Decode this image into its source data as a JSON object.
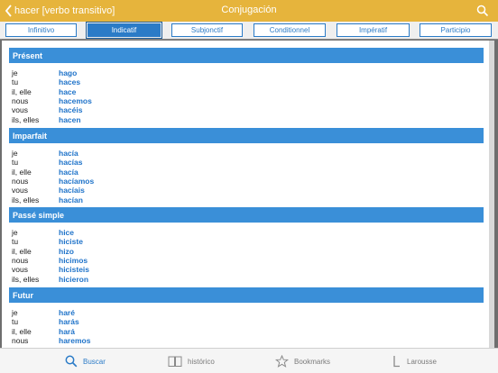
{
  "header": {
    "back_label": "hacer [verbo transitivo]",
    "title": "Conjugación"
  },
  "tabs": [
    {
      "label": "Infinitivo"
    },
    {
      "label": "Indicatif"
    },
    {
      "label": "Subjonctif"
    },
    {
      "label": "Conditionnel"
    },
    {
      "label": "Impératif"
    },
    {
      "label": "Participio"
    }
  ],
  "sections": [
    {
      "title": "Présent",
      "rows": [
        {
          "pronoun": "je",
          "form": "hago"
        },
        {
          "pronoun": "tu",
          "form": "haces"
        },
        {
          "pronoun": "il, elle",
          "form": "hace"
        },
        {
          "pronoun": "nous",
          "form": "hacemos"
        },
        {
          "pronoun": "vous",
          "form": "hacéis"
        },
        {
          "pronoun": "ils, elles",
          "form": "hacen"
        }
      ]
    },
    {
      "title": "Imparfait",
      "rows": [
        {
          "pronoun": "je",
          "form": "hacía"
        },
        {
          "pronoun": "tu",
          "form": "hacías"
        },
        {
          "pronoun": "il, elle",
          "form": "hacía"
        },
        {
          "pronoun": "nous",
          "form": "hacíamos"
        },
        {
          "pronoun": "vous",
          "form": "hacíais"
        },
        {
          "pronoun": "ils, elles",
          "form": "hacían"
        }
      ]
    },
    {
      "title": "Passé simple",
      "rows": [
        {
          "pronoun": "je",
          "form": "hice"
        },
        {
          "pronoun": "tu",
          "form": "hiciste"
        },
        {
          "pronoun": "il, elle",
          "form": "hizo"
        },
        {
          "pronoun": "nous",
          "form": "hicimos"
        },
        {
          "pronoun": "vous",
          "form": "hicisteis"
        },
        {
          "pronoun": "ils, elles",
          "form": "hicieron"
        }
      ]
    },
    {
      "title": "Futur",
      "rows": [
        {
          "pronoun": "je",
          "form": "haré"
        },
        {
          "pronoun": "tu",
          "form": "harás"
        },
        {
          "pronoun": "il, elle",
          "form": "hará"
        },
        {
          "pronoun": "nous",
          "form": "haremos"
        }
      ]
    }
  ],
  "bottom_nav": [
    {
      "label": "Buscar",
      "icon": "search-icon"
    },
    {
      "label": "histórico",
      "icon": "book-icon"
    },
    {
      "label": "Bookmarks",
      "icon": "star-icon"
    },
    {
      "label": "Larousse",
      "icon": "larousse-logo-icon"
    }
  ],
  "colors": {
    "header": "#e6b43c",
    "accent": "#2b7bc7",
    "section_head": "#3a8fd8",
    "verb": "#1f73c9"
  }
}
